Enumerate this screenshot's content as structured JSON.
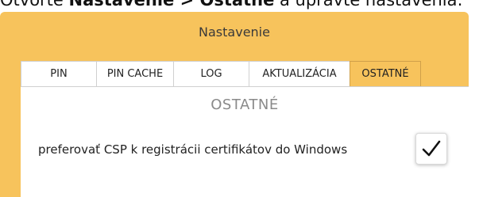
{
  "doc_line": {
    "prefix": "Otvorte ",
    "bold1": "Nastavenie",
    "sep": " > ",
    "bold2": "Ostatné",
    "suffix": " a upravte nastavenia:"
  },
  "window": {
    "title": "Nastavenie"
  },
  "tabs": [
    {
      "label": "PIN",
      "active": false
    },
    {
      "label": "PIN CACHE",
      "active": false
    },
    {
      "label": "LOG",
      "active": false
    },
    {
      "label": "AKTUALIZÁCIA",
      "active": false
    },
    {
      "label": "OSTATNÉ",
      "active": true
    }
  ],
  "panel": {
    "section_title": "OSTATNÉ",
    "option": {
      "label": "preferovať CSP k registrácii certifikátov do Windows",
      "checked": true
    }
  },
  "colors": {
    "accent": "#f7c35c",
    "section_title": "#8a8a8a"
  },
  "icons": {
    "checkbox_mark": "check-icon"
  }
}
